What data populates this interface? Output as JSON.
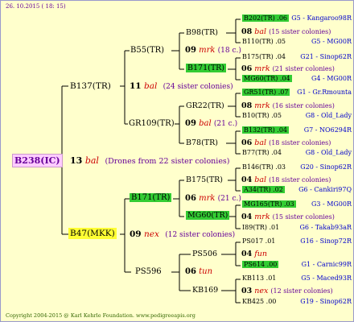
{
  "header": {
    "date": "26. 10.2015 ( 18: 15)"
  },
  "footer": {
    "copyright": "Copyright 2004-2015 @ Karl Kehrle Foundation.   www.pedigreeapis.org"
  },
  "root": {
    "id": "B238(IC)",
    "num": "13",
    "breeder": "bal",
    "note": "(Drones from 22 sister colonies)"
  },
  "l1": [
    {
      "id": "B137(TR)",
      "num": "11",
      "breeder": "bal",
      "note": "(24 sister colonies)"
    },
    {
      "id": "B47(MKK)",
      "num": "09",
      "breeder": "nex",
      "note": "(12 sister colonies)"
    }
  ],
  "l2": [
    {
      "id": "B55(TR)",
      "num": "09",
      "breeder": "mrk",
      "note": "(18 c.)"
    },
    {
      "id": "GR109(TR)",
      "num": "09",
      "breeder": "bal",
      "note": "(21 c.)"
    },
    {
      "id": "B171(TR)",
      "num": "06",
      "breeder": "mrk",
      "note": "(21 c.)"
    },
    {
      "id": "PS596",
      "num": "06",
      "breeder": "tun",
      "note": ""
    }
  ],
  "l3": [
    {
      "id": "B98(TR)",
      "num": "08",
      "breeder": "bal",
      "note": "(15 sister colonies)"
    },
    {
      "id": "B171(TR)",
      "num": "06",
      "breeder": "mrk",
      "note": "(21 sister colonies)"
    },
    {
      "id": "GR22(TR)",
      "num": "08",
      "breeder": "mrk",
      "note": "(16 sister colonies)"
    },
    {
      "id": "B78(TR)",
      "num": "06",
      "breeder": "bal",
      "note": "(18 sister colonies)"
    },
    {
      "id": "B175(TR)",
      "num": "04",
      "breeder": "bal",
      "note": "(18 sister colonies)"
    },
    {
      "id": "MG60(TR)",
      "num": "04",
      "breeder": "mrk",
      "note": "(15 sister colonies)"
    },
    {
      "id": "PS506",
      "num": "04",
      "breeder": "fun",
      "note": ""
    },
    {
      "id": "KB169",
      "num": "03",
      "breeder": "nex",
      "note": "(12 sister colonies)"
    }
  ],
  "l4": [
    {
      "id": "B202(TR) .06",
      "id2": "G5 - Kangaroo98R"
    },
    {
      "id": "B110(TR) .05",
      "id2": "G5 - MG00R"
    },
    {
      "id": "B175(TR) .04",
      "id2": "G21 - Sinop62R"
    },
    {
      "id": "MG60(TR) .04",
      "id2": "G4 - MG00R"
    },
    {
      "id": "GR51(TR) .07",
      "id2": "G1 - Gr.Rmounta"
    },
    {
      "id": "B10(TR) .05",
      "id2": "G8 - Old_Lady"
    },
    {
      "id": "B132(TR) .04",
      "id2": "G7 - NO6294R"
    },
    {
      "id": "B77(TR) .04",
      "id2": "G8 - Old_Lady"
    },
    {
      "id": "B146(TR) .03",
      "id2": "G20 - Sinop62R"
    },
    {
      "id": "A34(TR) .02",
      "id2": "G6 - Cankiri97Q"
    },
    {
      "id": "MG165(TR) .03",
      "id2": "G3 - MG00R"
    },
    {
      "id": "I89(TR) .01",
      "id2": "G6 - Takab93aR"
    },
    {
      "id": "PS017 .01",
      "id2": "G16 - Sinop72R"
    },
    {
      "id": "PS614 .00",
      "id2": "G1 - Carnic99R"
    },
    {
      "id": "KB113 .01",
      "id2": "G5 - Maced93R"
    },
    {
      "id": "KB425 .00",
      "id2": "G19 - Sinop62R"
    }
  ]
}
